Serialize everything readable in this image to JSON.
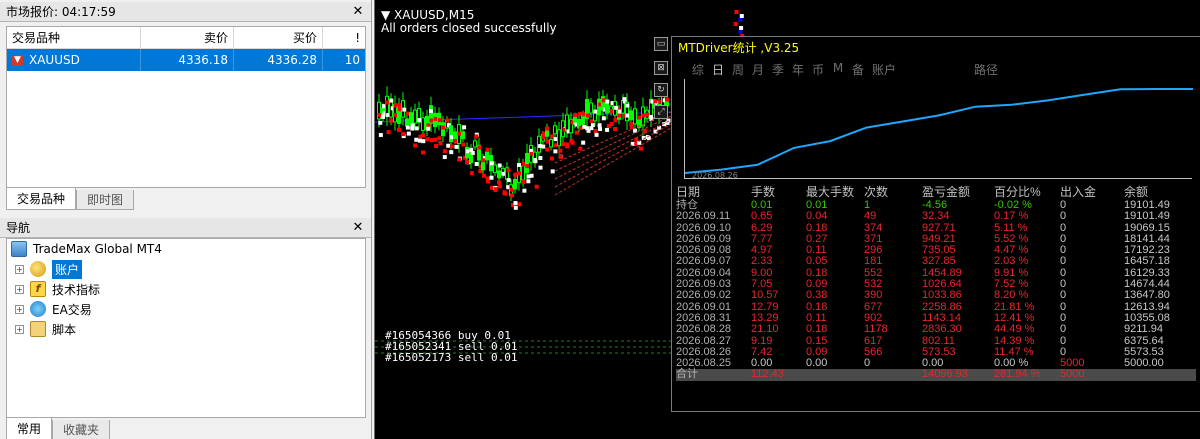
{
  "market_watch": {
    "title": "市场报价: 04:17:59",
    "columns": [
      "交易品种",
      "卖价",
      "买价",
      "!"
    ],
    "rows": [
      {
        "symbol": "XAUUSD",
        "bid": "4336.18",
        "ask": "4336.28",
        "spread": "10"
      }
    ],
    "tabs": [
      "交易品种",
      "即时图"
    ]
  },
  "navigator": {
    "title": "导航",
    "root": "TradeMax Global MT4",
    "items": [
      "账户",
      "技术指标",
      "EA交易",
      "脚本"
    ],
    "tabs": [
      "常用",
      "收藏夹"
    ]
  },
  "chart": {
    "title": "XAUUSD,M15",
    "message": "All orders closed successfully",
    "orders": [
      "#165054366 buy 0.01",
      "#165052341 sell 0.01",
      "#165052173 sell 0.01"
    ],
    "candle_color": "#00ff00",
    "marker_colors": [
      "#ff0000",
      "#ffffff",
      "#0000ff"
    ]
  },
  "mtdriver": {
    "title": "MTDriver统计  ,V3.25",
    "tabs": [
      "综",
      "日",
      "周",
      "月",
      "季",
      "年",
      "币",
      "M",
      "备",
      "账户",
      "路径"
    ],
    "active_tab": "日",
    "equity_curve": {
      "start_label": "2026.08.26",
      "y": [
        5000.0,
        5573.53,
        6375.64,
        9211.94,
        10355.08,
        12613.94,
        13647.8,
        14674.44,
        16129.33,
        16457.18,
        17192.23,
        18141.44,
        19069.15,
        19101.49,
        19101.49
      ],
      "line_color": "#1ea7ff"
    },
    "headers": [
      "日期",
      "手数",
      "最大手数",
      "次数",
      "盈亏金额",
      "百分比%",
      "出入金",
      "余额"
    ],
    "position_row": {
      "date": "持仓",
      "lots": "0.01",
      "max": "0.01",
      "count": "1",
      "pnl": "-4.56",
      "pct": "-0.02 %",
      "flow": "0",
      "balance": "19101.49"
    },
    "rows": [
      {
        "date": "2026.09.11",
        "lots": "0.65",
        "max": "0.04",
        "count": "49",
        "pnl": "32.34",
        "pct": "0.17 %",
        "flow": "0",
        "balance": "19101.49"
      },
      {
        "date": "2026.09.10",
        "lots": "6.29",
        "max": "0.18",
        "count": "374",
        "pnl": "927.71",
        "pct": "5.11 %",
        "flow": "0",
        "balance": "19069.15"
      },
      {
        "date": "2026.09.09",
        "lots": "7.77",
        "max": "0.27",
        "count": "371",
        "pnl": "949.21",
        "pct": "5.52 %",
        "flow": "0",
        "balance": "18141.44"
      },
      {
        "date": "2026.09.08",
        "lots": "4.97",
        "max": "0.11",
        "count": "296",
        "pnl": "735.05",
        "pct": "4.47 %",
        "flow": "0",
        "balance": "17192.23"
      },
      {
        "date": "2026.09.07",
        "lots": "2.33",
        "max": "0.05",
        "count": "181",
        "pnl": "327.85",
        "pct": "2.03 %",
        "flow": "0",
        "balance": "16457.18"
      },
      {
        "date": "2026.09.04",
        "lots": "9.00",
        "max": "0.18",
        "count": "552",
        "pnl": "1454.89",
        "pct": "9.91 %",
        "flow": "0",
        "balance": "16129.33"
      },
      {
        "date": "2026.09.03",
        "lots": "7.05",
        "max": "0.09",
        "count": "532",
        "pnl": "1026.64",
        "pct": "7.52 %",
        "flow": "0",
        "balance": "14674.44"
      },
      {
        "date": "2026.09.02",
        "lots": "10.57",
        "max": "0.38",
        "count": "390",
        "pnl": "1033.86",
        "pct": "8.20 %",
        "flow": "0",
        "balance": "13647.80"
      },
      {
        "date": "2026.09.01",
        "lots": "12.79",
        "max": "0.18",
        "count": "677",
        "pnl": "2258.86",
        "pct": "21.81 %",
        "flow": "0",
        "balance": "12613.94"
      },
      {
        "date": "2026.08.31",
        "lots": "13.29",
        "max": "0.11",
        "count": "902",
        "pnl": "1143.14",
        "pct": "12.41 %",
        "flow": "0",
        "balance": "10355.08"
      },
      {
        "date": "2026.08.28",
        "lots": "21.10",
        "max": "0.18",
        "count": "1178",
        "pnl": "2836.30",
        "pct": "44.49 %",
        "flow": "0",
        "balance": "9211.94"
      },
      {
        "date": "2026.08.27",
        "lots": "9.19",
        "max": "0.15",
        "count": "617",
        "pnl": "802.11",
        "pct": "14.39 %",
        "flow": "0",
        "balance": "6375.64"
      },
      {
        "date": "2026.08.26",
        "lots": "7.42",
        "max": "0.09",
        "count": "566",
        "pnl": "573.53",
        "pct": "11.47 %",
        "flow": "0",
        "balance": "5573.53"
      },
      {
        "date": "2026.08.25",
        "lots": "0.00",
        "max": "0.00",
        "count": "0",
        "pnl": "0.00",
        "pct": "0.00 %",
        "flow": "5000",
        "balance": "5000.00"
      }
    ],
    "total_row": {
      "date": "合计",
      "lots": "112.43",
      "pnl": "14096.93",
      "pct": "281.94 %",
      "flow": "5000"
    }
  }
}
